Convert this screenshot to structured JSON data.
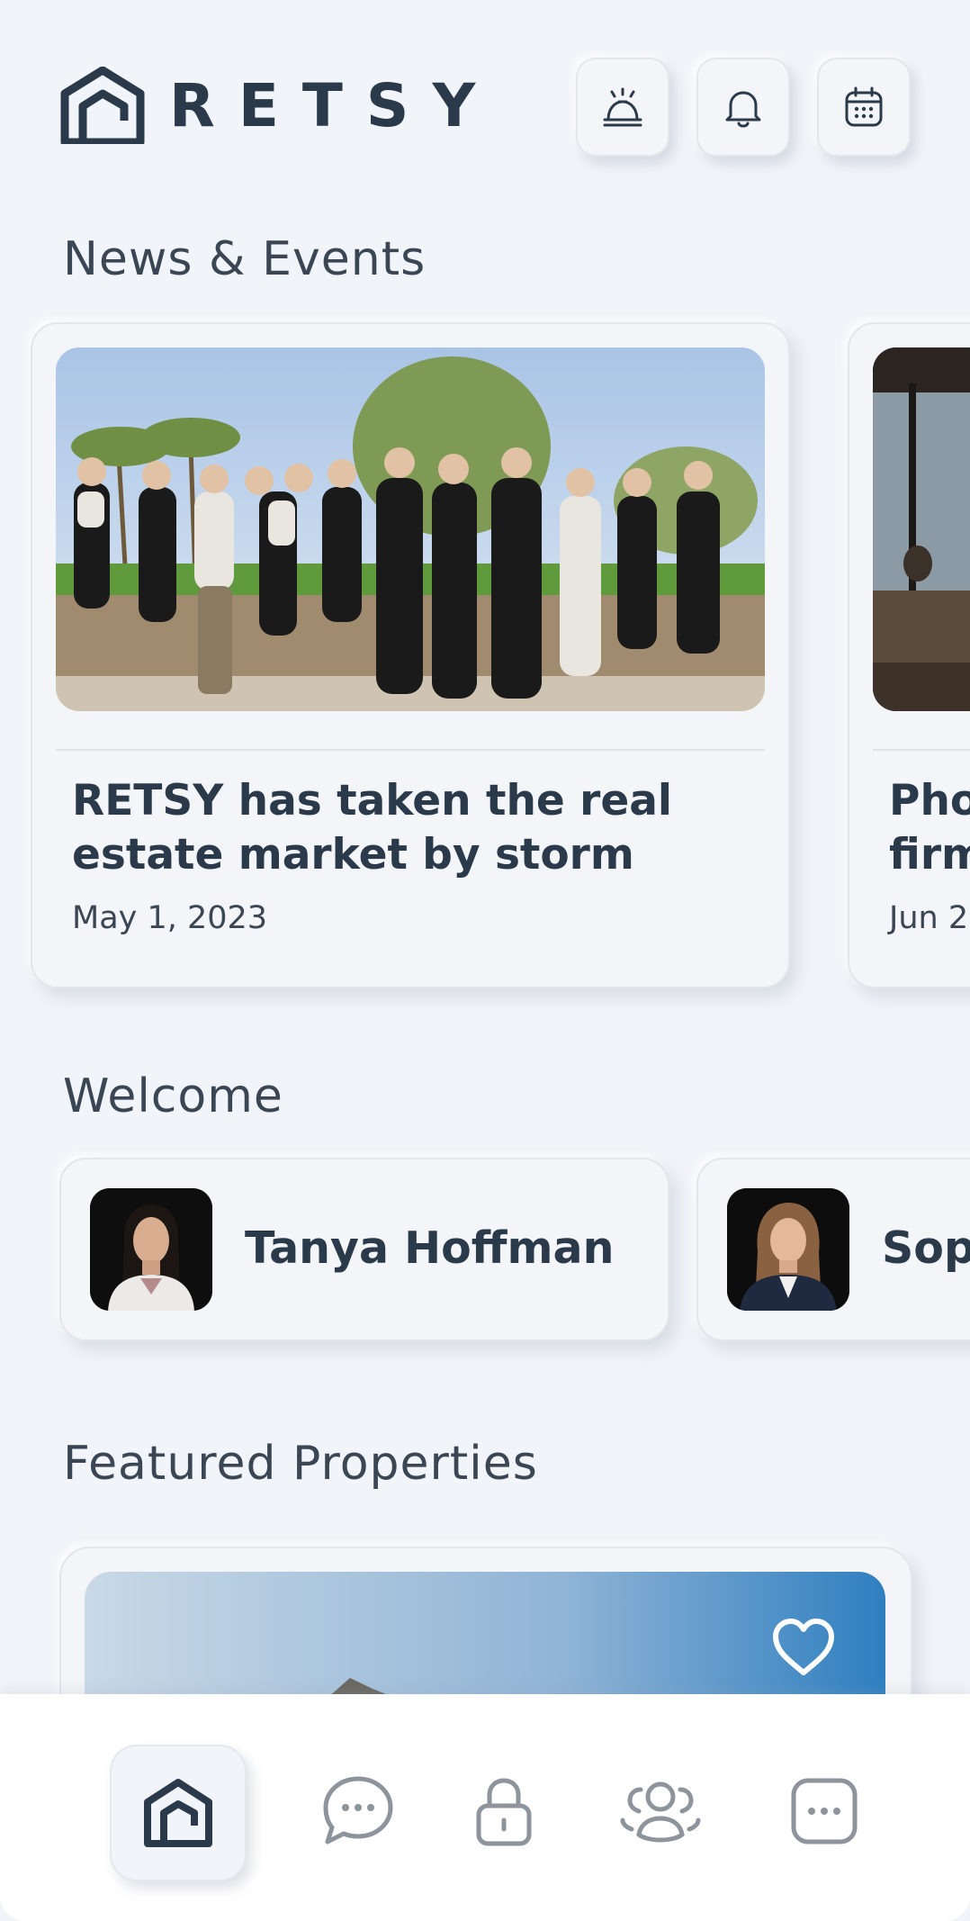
{
  "brand": {
    "name": "RETSY"
  },
  "header": {
    "buttons": [
      {
        "icon": "service-bell-icon"
      },
      {
        "icon": "bell-icon"
      },
      {
        "icon": "calendar-icon"
      }
    ]
  },
  "news": {
    "title": "News & Events",
    "cards": [
      {
        "title": "RETSY has taken the real estate market by storm",
        "date": "May 1, 2023"
      },
      {
        "title": "Pho firm",
        "date": "Jun 2"
      }
    ]
  },
  "welcome": {
    "title": "Welcome",
    "people": [
      {
        "name": "Tanya Hoffman"
      },
      {
        "name": "Sop"
      }
    ]
  },
  "featured": {
    "title": "Featured Properties"
  },
  "nav": {
    "items": [
      {
        "icon": "home-icon",
        "active": true
      },
      {
        "icon": "chat-icon"
      },
      {
        "icon": "lock-icon"
      },
      {
        "icon": "people-icon"
      },
      {
        "icon": "more-icon"
      }
    ]
  },
  "colors": {
    "background": "#f1f4f8",
    "text": "#2b3a4a",
    "accent": "#2b3a4a",
    "card": "#f3f5f8"
  }
}
